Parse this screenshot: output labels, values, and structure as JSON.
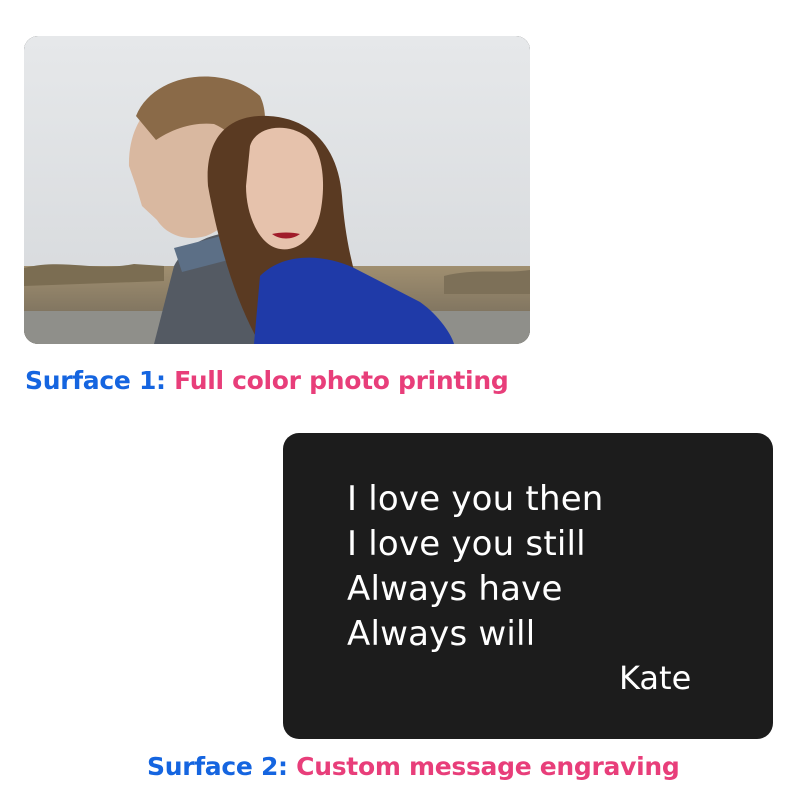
{
  "photo_card": {
    "image": "couple-portrait-photo",
    "colors": {
      "sky": "#dfe2e5",
      "grass": "#8a7a5a",
      "sweater_blue": "#1f3aa8",
      "sweater_gray": "#545a63",
      "hair": "#5a3a22"
    }
  },
  "surface1": {
    "lead": "Surface 1:",
    "desc": "Full color photo printing"
  },
  "engraving": {
    "lines": [
      "I love you then",
      "I love you still",
      "Always have",
      "Always will"
    ],
    "signature": "Kate"
  },
  "surface2": {
    "lead": "Surface 2:",
    "desc": "Custom message engraving"
  },
  "colors": {
    "lead": "#1565e0",
    "desc": "#e83e7a",
    "card_dark": "#1c1c1c"
  }
}
